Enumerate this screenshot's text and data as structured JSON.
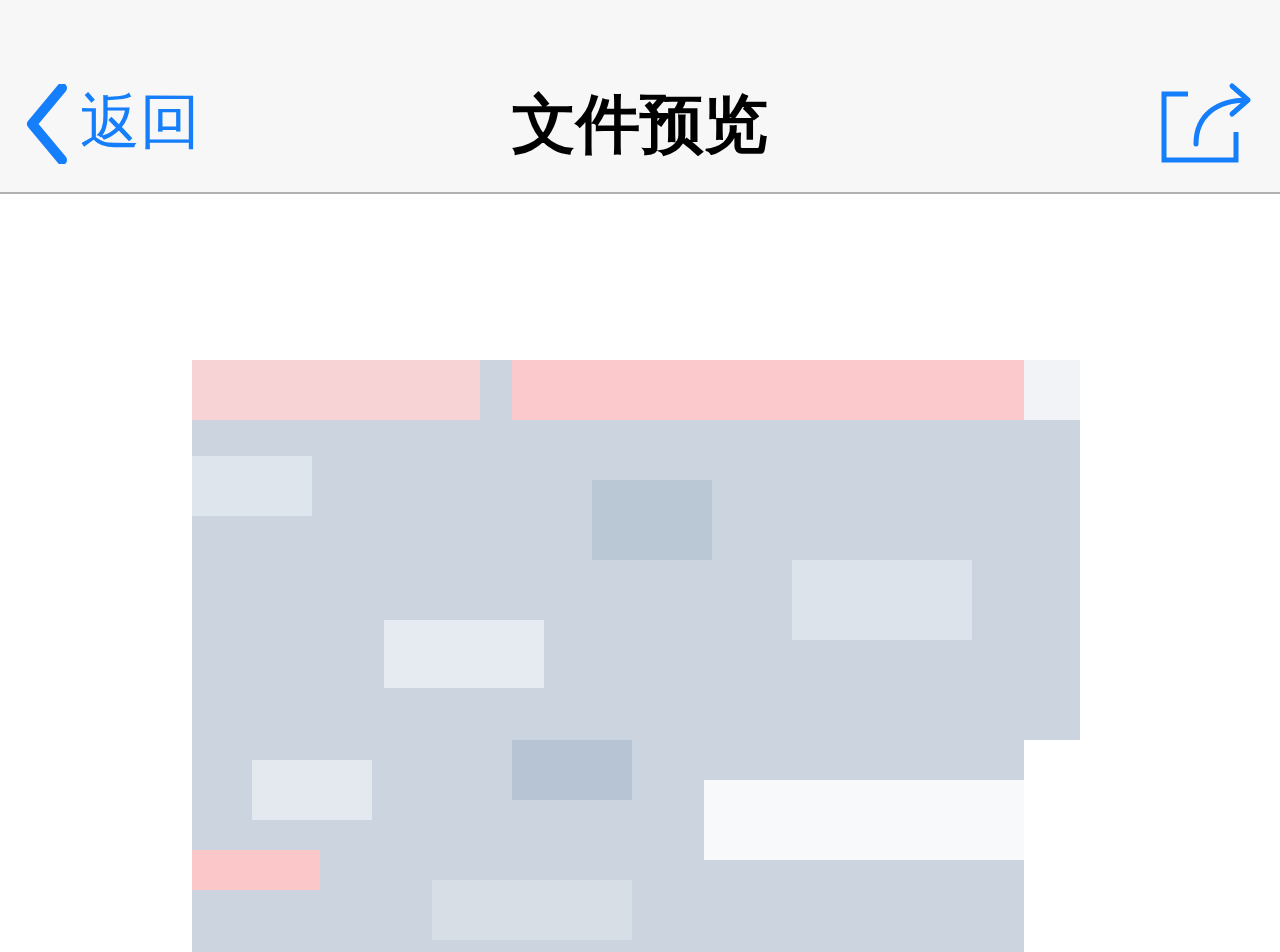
{
  "nav_bar": {
    "back_label": "返回",
    "title": "文件预览"
  }
}
